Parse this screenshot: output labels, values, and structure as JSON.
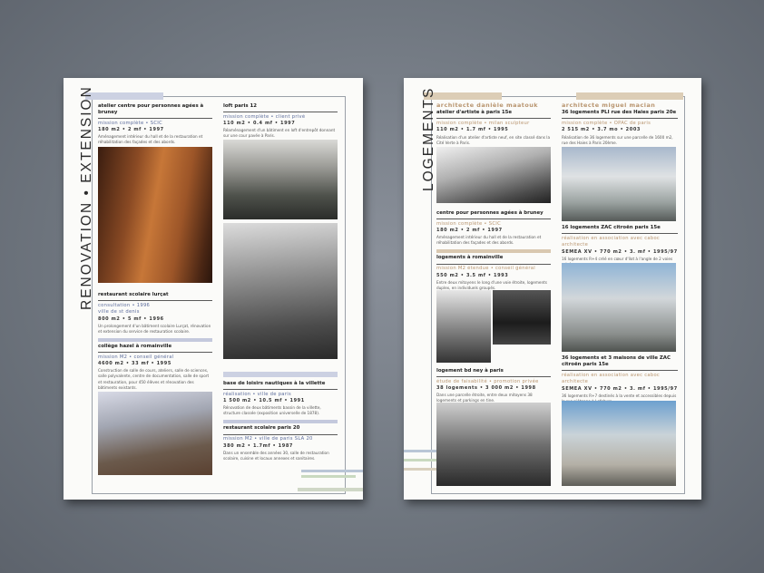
{
  "left": {
    "vertical_title": "RENOVATION • EXTENSION",
    "col1": [
      {
        "title": "atelier centre pour personnes agées à bruney",
        "lines": [
          "mission complète • SCIC"
        ],
        "stats": "180 m2 • 2 mf • 1997",
        "desc": "Aménagement intérieur du hall et de la restauration et réhabilitation des façades et des abords."
      },
      {
        "title": "restaurant scolaire lurçat",
        "lines": [
          "consultation • 1996",
          "ville de st denis"
        ],
        "stats": "800 m2 • 5 mf • 1996",
        "desc": "Un prolongement d'un bâtiment scolaire Lurçat, rénovation et extension du service de restauration scolaire."
      },
      {
        "title": "collège hazel à romainville",
        "lines": [
          "mission M2 • conseil général"
        ],
        "stats": "4600 m2 • 33 mf • 1995",
        "desc": "Construction de salle de cours, ateliers, salle de sciences, salle polyvalente, centre de documentation, salle de sport et restauration, pour 450 élèves et rénovation des bâtiments existants."
      }
    ],
    "col2": [
      {
        "title": "loft paris 12",
        "lines": [
          "mission complète • client privé"
        ],
        "stats": "110 m2 • 0.4 mf • 1997",
        "desc": "Réaménagement d'un bâtiment en loft d'entrepôt donnant sur une cour pavée à Paris."
      },
      {
        "title": "base de loisirs nautiques à la villette",
        "lines": [
          "réalisation • ville de paris"
        ],
        "stats": "1 500 m2 • 10.5 mf • 1991",
        "desc": "Rénovation de deux bâtiments bassin de la villette, structure classée (exposition universelle de 1878)."
      },
      {
        "title": "restaurant scolaire paris 20",
        "lines": [
          "mission M2 • ville de paris SLA 20"
        ],
        "stats": "380 m2 • 1.7mf • 1987",
        "desc": "Dans un ensemble des années 30, salle de restauration scolaire, cuisine et locaux annexes et sanitaires."
      }
    ]
  },
  "right": {
    "vertical_title": "LOGEMENTS",
    "col1": {
      "heading": "architecte danièle maatouk",
      "entries": [
        {
          "title": "atelier d'artiste à paris 15e",
          "lines": [
            "mission complète • milan sculpteur"
          ],
          "stats": "110 m2 • 1.7 mf • 1995",
          "desc": "Réalisation d'un atelier d'artiste neuf, en site classé dans la Cité Verte à Paris."
        },
        {
          "title": "centre pour personnes agées à bruney",
          "lines": [
            "mission complète • SCIC"
          ],
          "stats": "180 m2 • 2 mf • 1997",
          "desc": "Aménagement intérieur du hall et de la restauration et réhabilitation des façades et des abords."
        },
        {
          "title": "logements à romainville",
          "lines": [
            "mission M2 étendue • conseil général"
          ],
          "stats": "550 m2 • 3.5 mf • 1993",
          "desc": "Entre deux mitoyens le long d'une voie étroite, logements duplex, en individuels groupés."
        },
        {
          "title": "logement bd ney à paris",
          "lines": [
            "étude de faisabilité • promotion privée"
          ],
          "stats": "38 logements • 3 000 m2 • 1998",
          "desc": "Dans une parcelle étroite, entre deux mitoyens 38 logements et parkings en tine."
        }
      ]
    },
    "col2": {
      "heading": "architecte miguel macian",
      "entries": [
        {
          "title": "36 logements PLI rue des Haies paris 20e",
          "lines": [
            "mission complète • OPAC de paris"
          ],
          "stats": "2 515 m2 • 3.7 mo • 2003",
          "desc": "Réalisation de 36 logements sur une parcelle de 1600 m2, rue des Haies à Paris 20ème."
        },
        {
          "title": "16 logements ZAC citroën paris 15e",
          "lines": [
            "réalisation en association avec caboc architecte",
            "SEMEA XV • 770 m2 • 3. mf • 1995/97"
          ],
          "stats": "",
          "desc": "16 logements R+4 créé en cœur d'îlot à l'angle de 2 voies privées."
        },
        {
          "title": "36 logements et 3 maisons de ville ZAC citroën paris 15e",
          "lines": [
            "réalisation en association avec caboc architecte",
            "SEMEA XV • 770 m2 • 3. mf • 1995/97"
          ],
          "stats": "",
          "desc": "36 logements R+7 destinés à la vente et accessibles depuis la rue piétonne à Lefebvre."
        }
      ]
    }
  }
}
